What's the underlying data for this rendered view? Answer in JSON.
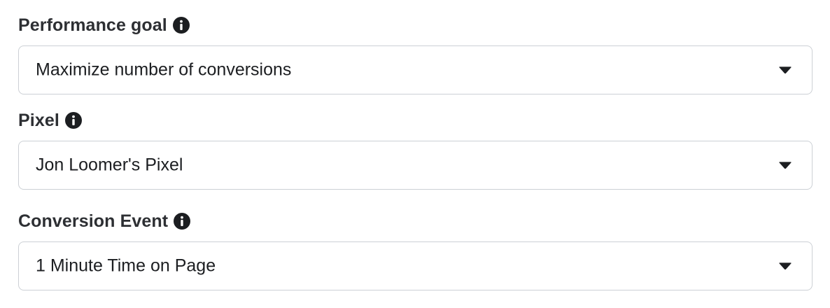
{
  "fields": [
    {
      "label": "Performance goal",
      "value": "Maximize number of conversions",
      "info_icon": "info-icon",
      "dropdown_icon": "caret-down-icon"
    },
    {
      "label": "Pixel",
      "value": "Jon Loomer's Pixel",
      "info_icon": "info-icon",
      "dropdown_icon": "caret-down-icon"
    },
    {
      "label": "Conversion Event",
      "value": "1 Minute Time on Page",
      "info_icon": "info-icon",
      "dropdown_icon": "caret-down-icon"
    }
  ],
  "colors": {
    "label_text": "#2d2f33",
    "value_text": "#1c1e21",
    "border": "#ccd0d5",
    "icon": "#1c1e21"
  }
}
